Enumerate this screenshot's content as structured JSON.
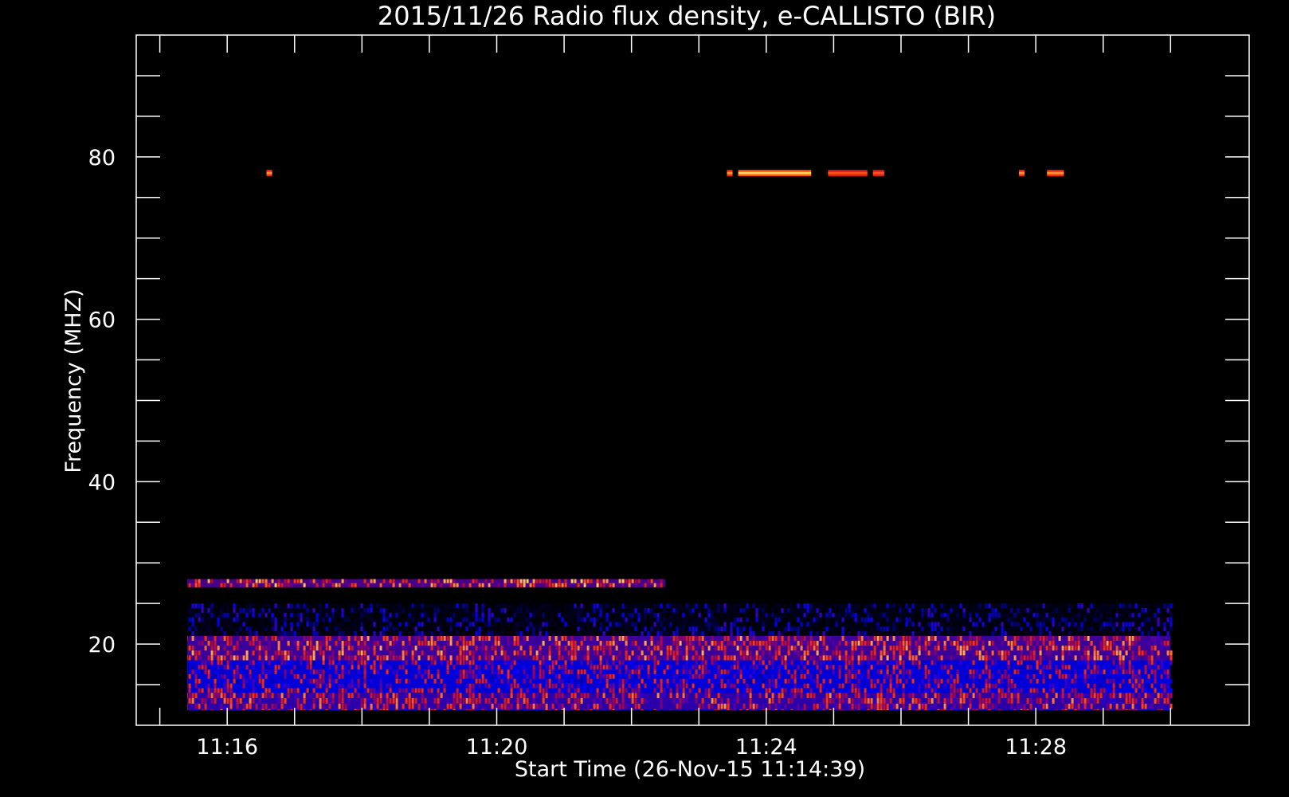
{
  "chart_data": {
    "type": "heatmap",
    "title": "2015/11/26  Radio flux density, e-CALLISTO (BIR)",
    "xlabel": "Start Time (26-Nov-15 11:14:39)",
    "ylabel": "Frequency (MHZ)",
    "x_unit": "UT time",
    "y_unit": "MHz",
    "xlim": [
      "11:14:39",
      "11:31:10"
    ],
    "data_time_range": [
      "11:15:00",
      "11:30:00"
    ],
    "ylim": [
      95,
      10
    ],
    "data_freq_range": [
      94,
      10
    ],
    "y_inverted": true,
    "x_ticks": [
      "11:16",
      "11:20",
      "11:24",
      "11:28"
    ],
    "y_ticks": [
      20,
      40,
      60,
      80
    ],
    "x_minor_ticks": [
      "11:15",
      "11:16",
      "11:17",
      "11:18",
      "11:19",
      "11:20",
      "11:21",
      "11:22",
      "11:23",
      "11:24",
      "11:25",
      "11:26",
      "11:27",
      "11:28",
      "11:29",
      "11:30"
    ],
    "y_minor_ticks": [
      15,
      20,
      25,
      30,
      35,
      40,
      45,
      50,
      55,
      60,
      65,
      70,
      75,
      80,
      85,
      90
    ],
    "colormap": [
      "#000000",
      "#0000ff",
      "#a00050",
      "#ff3000",
      "#ffd060"
    ],
    "background": "#0000ff",
    "grid": false,
    "legend": "none",
    "bands": [
      {
        "freq": [
          10,
          12
        ],
        "time": [
          "11:15:00",
          "11:30:00"
        ],
        "level": 0.55
      },
      {
        "freq": [
          12,
          14
        ],
        "time": [
          "11:15:00",
          "11:30:00"
        ],
        "level": 0.6
      },
      {
        "freq": [
          14,
          18
        ],
        "time": [
          "11:15:00",
          "11:30:00"
        ],
        "level": 0.45
      },
      {
        "freq": [
          18,
          21
        ],
        "time": [
          "11:15:00",
          "11:30:00"
        ],
        "level": 0.65
      },
      {
        "freq": [
          21,
          25
        ],
        "time": [
          "11:15:00",
          "11:30:00"
        ],
        "level": 0.05
      },
      {
        "freq": [
          27,
          28
        ],
        "time": [
          "11:15:00",
          "11:22:30"
        ],
        "level": 0.7
      }
    ],
    "features": [
      {
        "time": [
          "11:16:35",
          "11:16:40"
        ],
        "freq": 78,
        "level": 0.9
      },
      {
        "time": [
          "11:23:25",
          "11:23:30"
        ],
        "freq": 78,
        "level": 0.9
      },
      {
        "time": [
          "11:23:35",
          "11:24:40"
        ],
        "freq": 78,
        "level": 1.0
      },
      {
        "time": [
          "11:24:55",
          "11:25:30"
        ],
        "freq": 78,
        "level": 0.8
      },
      {
        "time": [
          "11:25:35",
          "11:25:45"
        ],
        "freq": 78,
        "level": 0.8
      },
      {
        "time": [
          "11:27:45",
          "11:27:50"
        ],
        "freq": 78,
        "level": 0.9
      },
      {
        "time": [
          "11:28:10",
          "11:28:25"
        ],
        "freq": 78,
        "level": 0.9
      }
    ]
  }
}
